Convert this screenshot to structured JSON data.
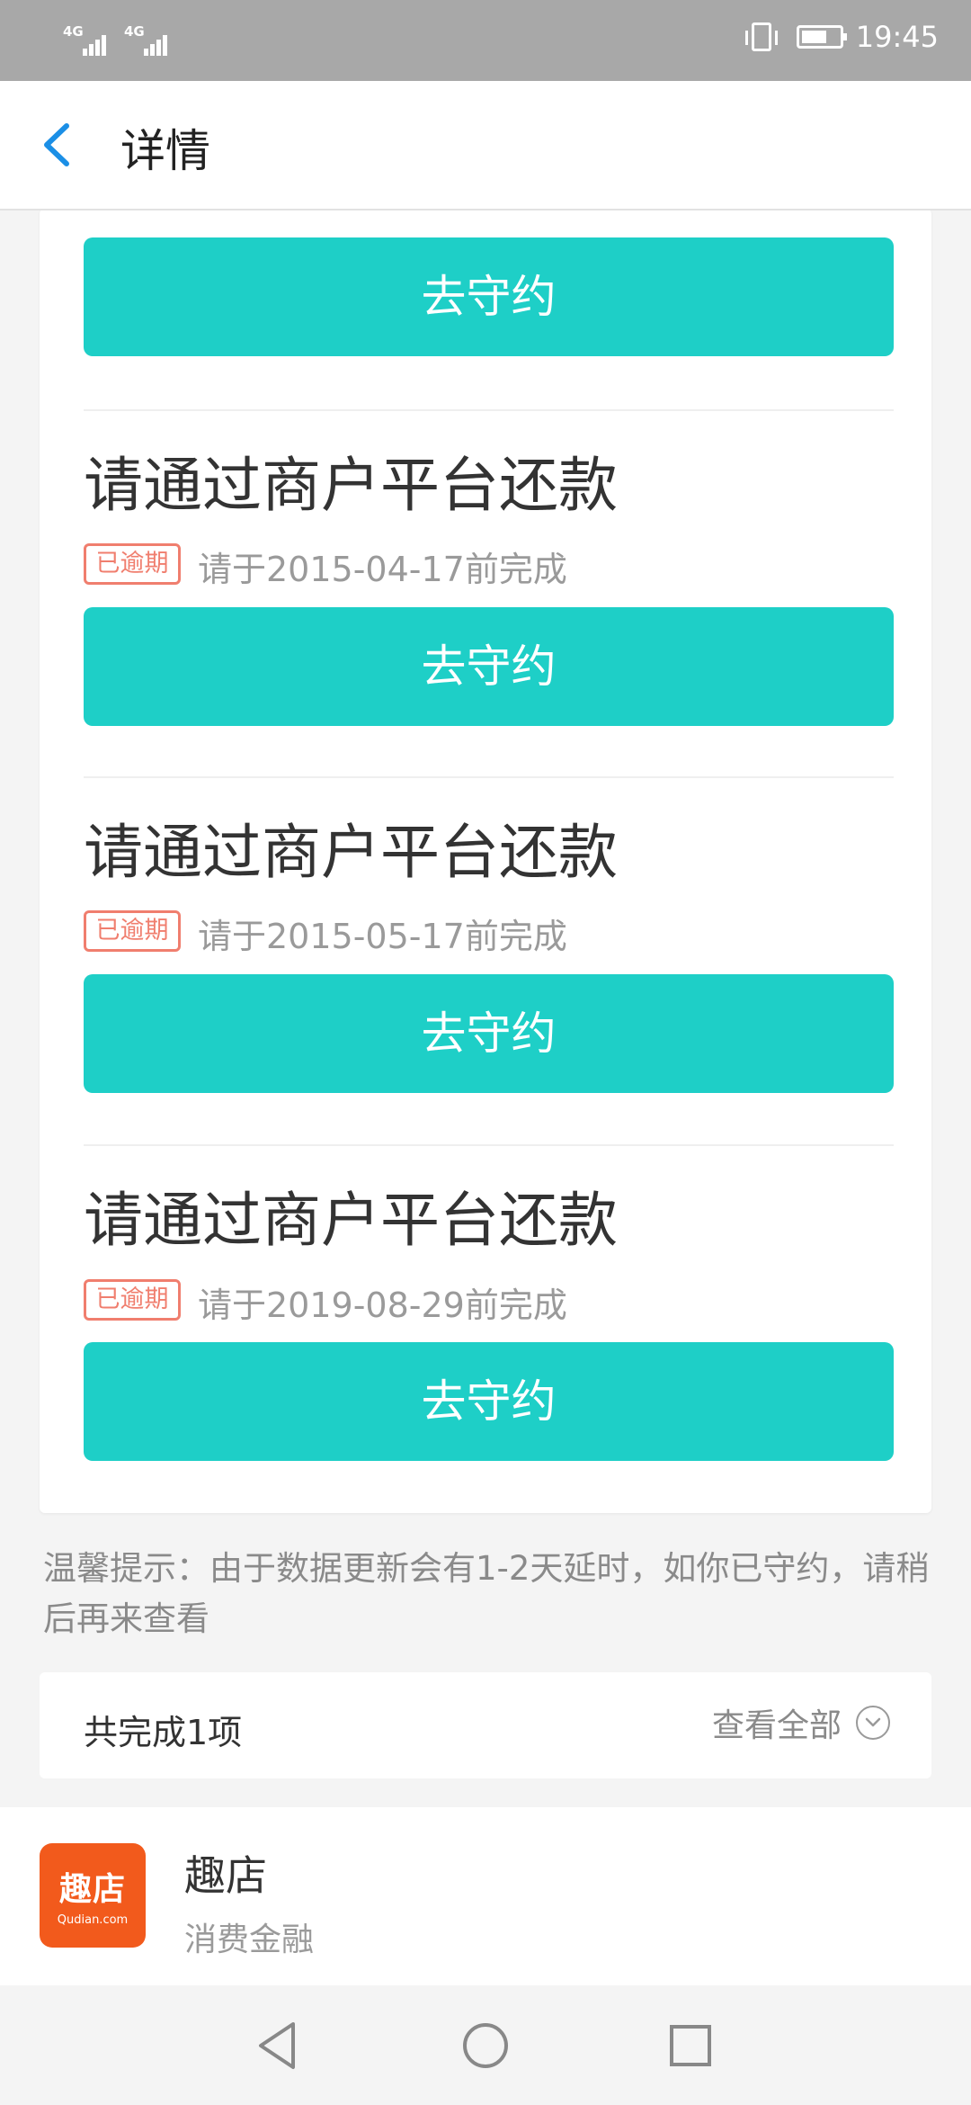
{
  "status_bar": {
    "time": "19:45",
    "network1": "4G",
    "network2": "4G"
  },
  "header": {
    "title": "详情",
    "back_icon": "chevron-left-icon",
    "accent_color": "#1b8fe6"
  },
  "items": [
    {
      "action_label": "去守约"
    },
    {
      "title": "请通过商户平台还款",
      "status": "已逾期",
      "deadline": "请于2015-04-17前完成",
      "action_label": "去守约"
    },
    {
      "title": "请通过商户平台还款",
      "status": "已逾期",
      "deadline": "请于2015-05-17前完成",
      "action_label": "去守约"
    },
    {
      "title": "请通过商户平台还款",
      "status": "已逾期",
      "deadline": "请于2019-08-29前完成",
      "action_label": "去守约"
    }
  ],
  "tip": "温馨提示：由于数据更新会有1-2天延时，如你已守约，请稍后再来查看",
  "completed": {
    "text": "共完成1项",
    "view_all": "查看全部"
  },
  "merchant": {
    "logo_text": "趣店",
    "logo_subtext": "Qudian.com",
    "name": "趣店",
    "category": "消费金融",
    "brand_color": "#f25a1c"
  },
  "colors": {
    "button": "#1ecfc7",
    "overdue": "#f07e6e"
  },
  "nav": [
    "back-triangle-icon",
    "home-circle-icon",
    "recents-square-icon"
  ]
}
